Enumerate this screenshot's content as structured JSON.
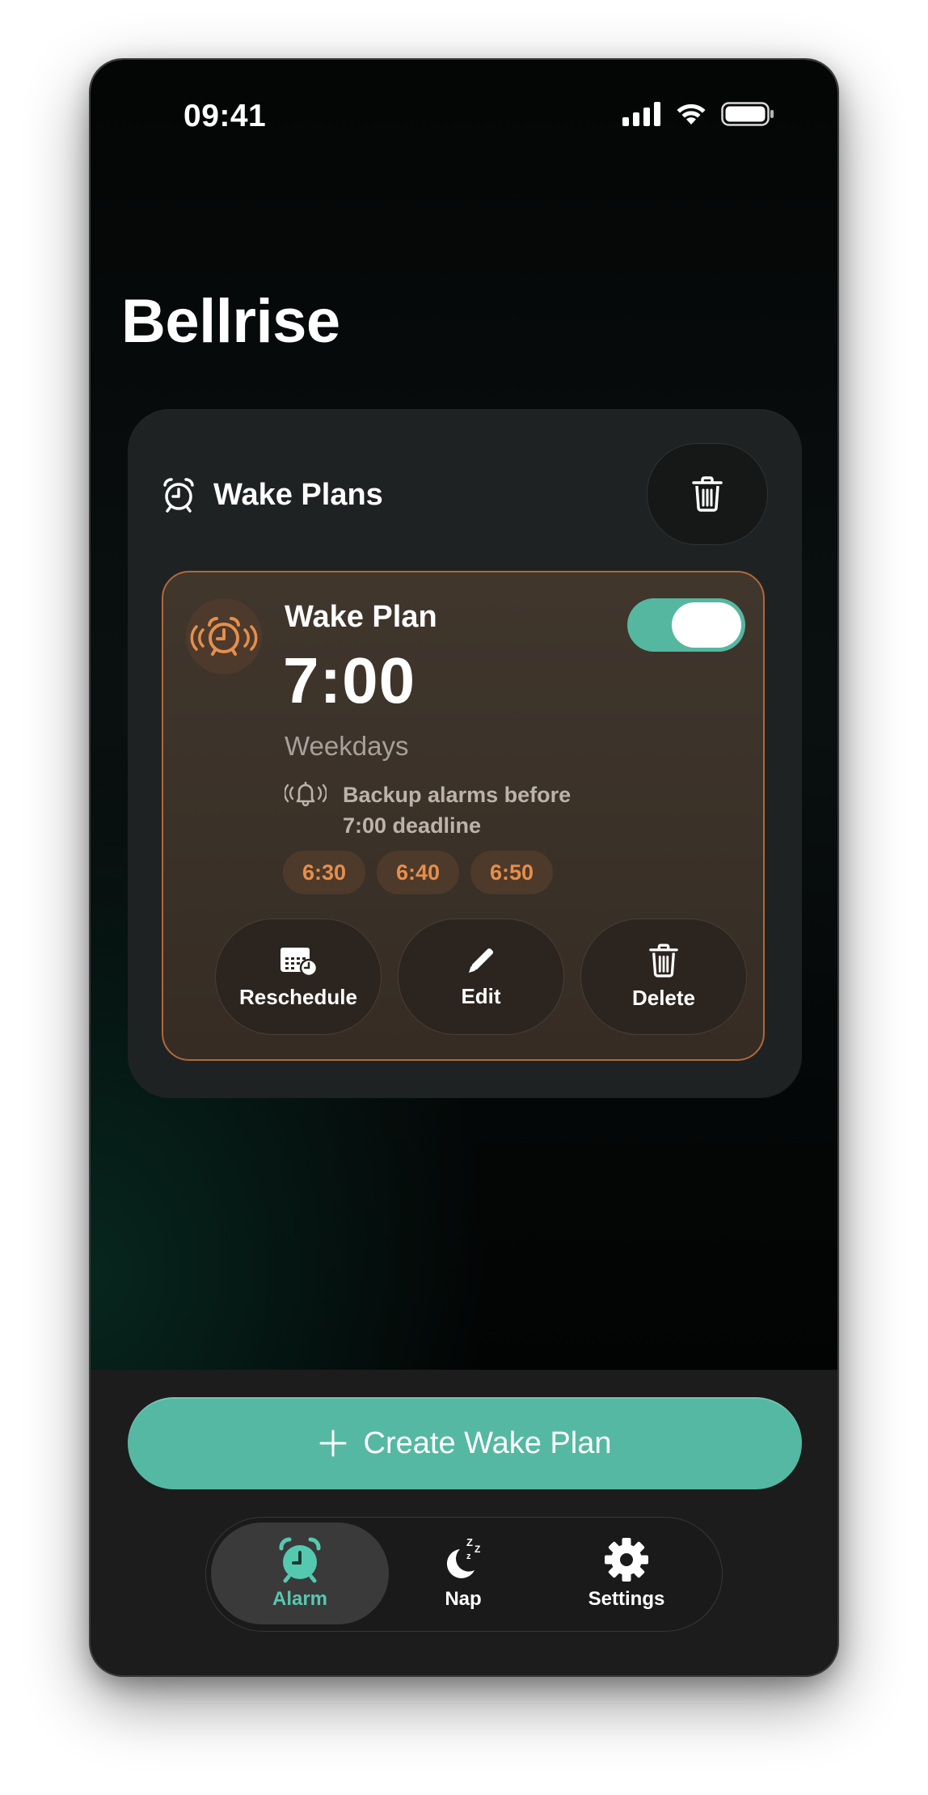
{
  "status_bar": {
    "time": "09:41"
  },
  "app": {
    "title": "Bellrise"
  },
  "plans_section": {
    "header_label": "Wake Plans"
  },
  "plan": {
    "name": "Wake Plan",
    "time": "7:00",
    "days": "Weekdays",
    "enabled": true,
    "backup_line1": "Backup alarms before",
    "backup_line2": "7:00 deadline",
    "backup_times": [
      "6:30",
      "6:40",
      "6:50"
    ],
    "actions": {
      "reschedule": "Reschedule",
      "edit": "Edit",
      "delete": "Delete"
    }
  },
  "create_button": {
    "label": "Create Wake Plan"
  },
  "tabs": [
    {
      "label": "Alarm",
      "icon": "alarm-clock-icon",
      "active": true
    },
    {
      "label": "Nap",
      "icon": "moon-zzz-icon",
      "active": false
    },
    {
      "label": "Settings",
      "icon": "gear-icon",
      "active": false
    }
  ],
  "colors": {
    "accent": "#55b8a2",
    "plan_accent": "#e58f4c",
    "plan_border": "#b0693a"
  }
}
